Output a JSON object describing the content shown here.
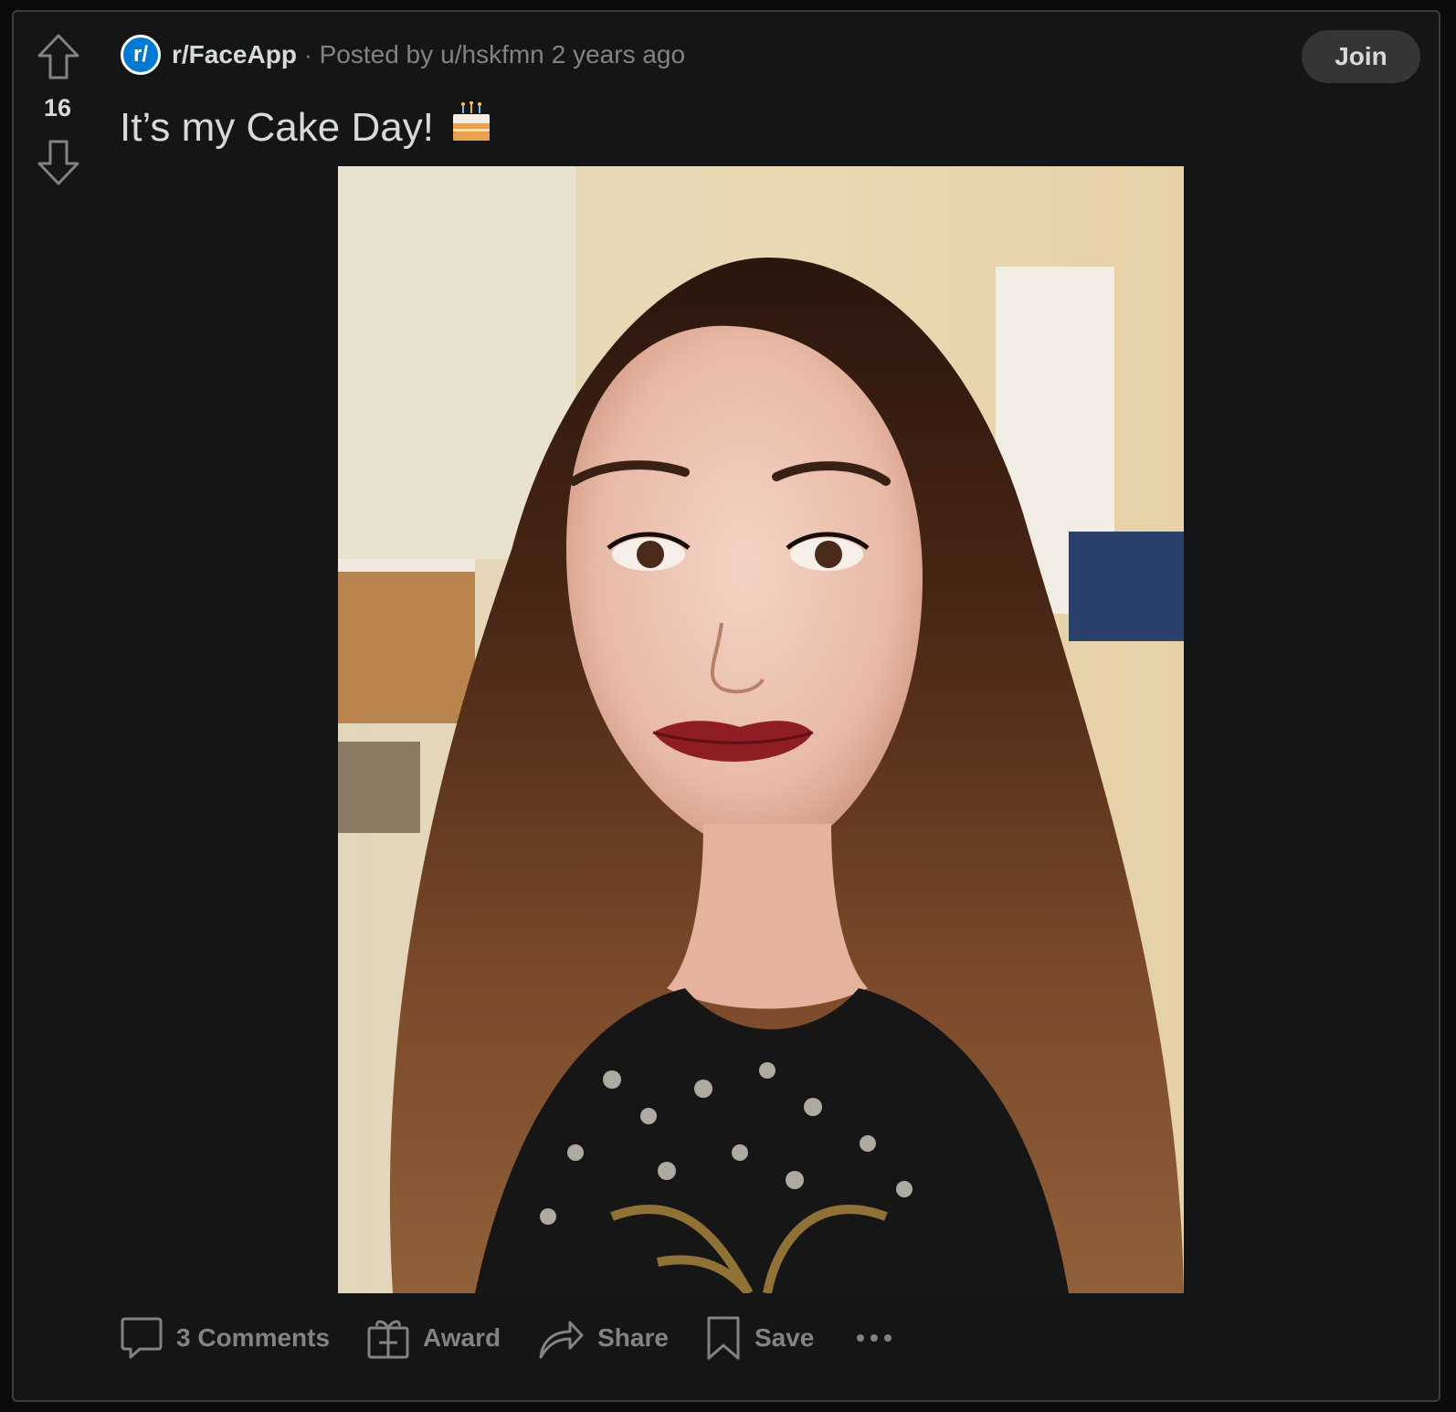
{
  "vote": {
    "score": "16"
  },
  "post": {
    "subreddit": "r/FaceApp",
    "subreddit_icon_text": "r/",
    "separator": "·",
    "posted_by": "Posted by",
    "author": "u/hskfmn",
    "time": "2 years ago",
    "title": "It’s my Cake Day!",
    "join_label": "Join"
  },
  "actions": {
    "comments": "3 Comments",
    "award": "Award",
    "share": "Share",
    "save": "Save"
  },
  "colors": {
    "background": "#131516",
    "text_primary": "#d7dadc",
    "text_secondary": "#818384",
    "subreddit_blue": "#0079d3",
    "join_bg": "#343536"
  },
  "icons": [
    "upvote-icon",
    "downvote-icon",
    "cake-icon",
    "comment-icon",
    "gift-icon",
    "share-icon",
    "bookmark-icon",
    "more-icon"
  ]
}
